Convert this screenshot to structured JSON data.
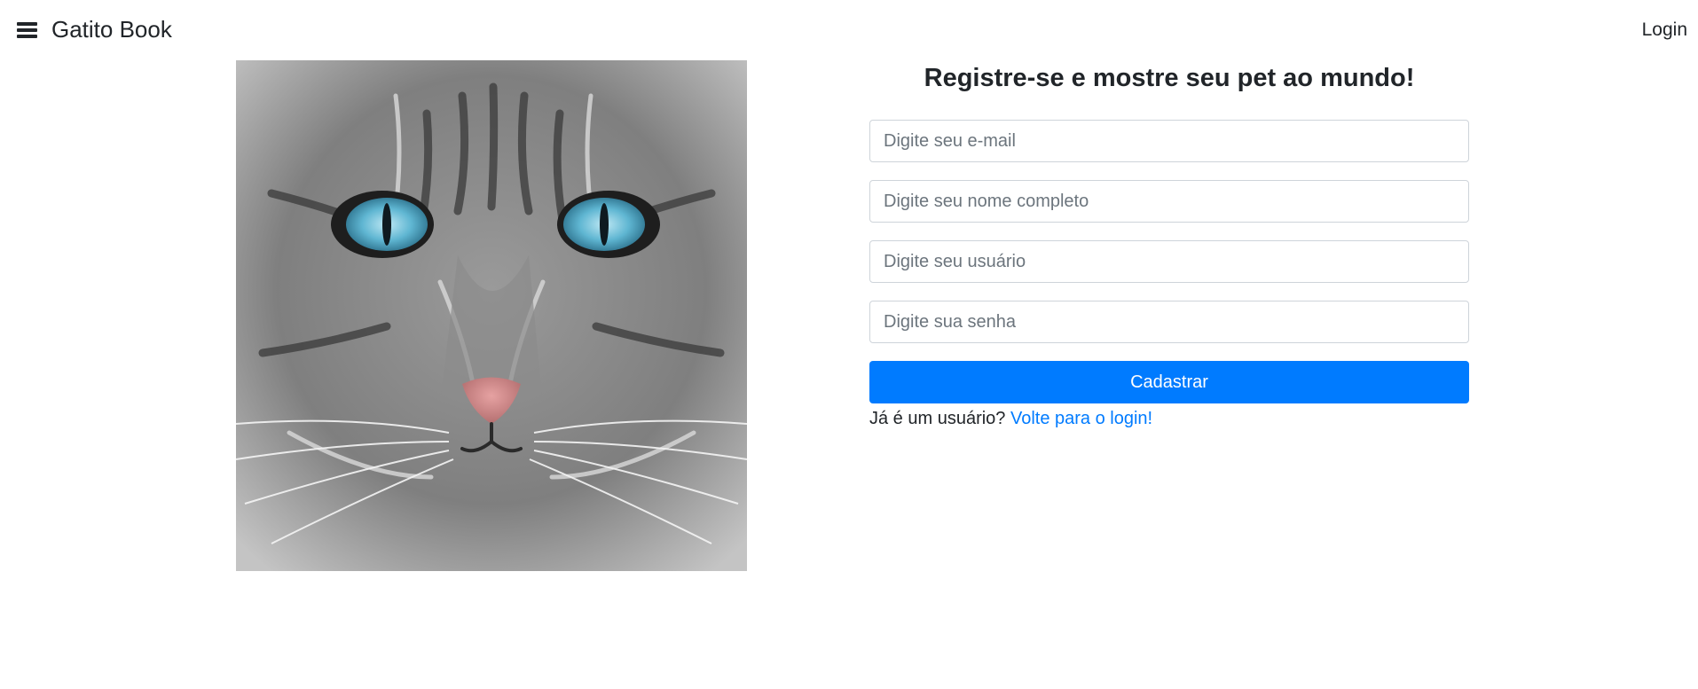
{
  "navbar": {
    "menu_icon": "hamburger-menu-icon",
    "brand": "Gatito Book",
    "login_link": "Login"
  },
  "hero_image": {
    "subject": "gray tabby cat face with blue eyes"
  },
  "register_form": {
    "title": "Registre-se e mostre seu pet ao mundo!",
    "email_placeholder": "Digite seu e-mail",
    "fullname_placeholder": "Digite seu nome completo",
    "username_placeholder": "Digite seu usuário",
    "password_placeholder": "Digite sua senha",
    "submit_label": "Cadastrar",
    "already_user_text": "Já é um usuário?",
    "back_to_login_link": "Volte para o login!"
  },
  "colors": {
    "primary": "#007bff",
    "text": "#212529",
    "border": "#ced4da"
  }
}
